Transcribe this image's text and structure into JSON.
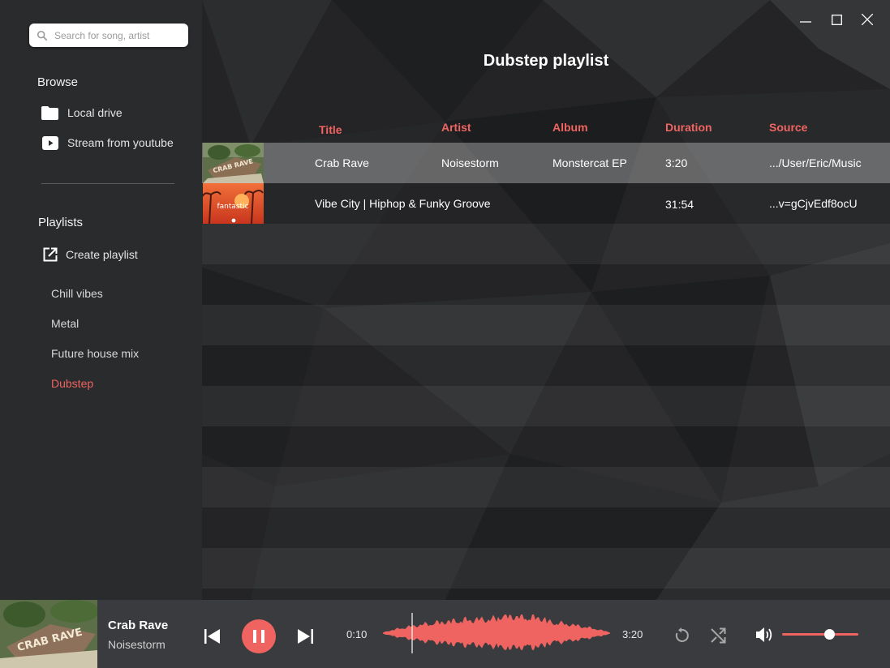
{
  "search": {
    "placeholder": "Search for song, artist"
  },
  "sidebar": {
    "browse_title": "Browse",
    "browse_items": [
      {
        "label": "Local drive",
        "icon": "folder-icon"
      },
      {
        "label": "Stream from youtube",
        "icon": "youtube-icon"
      }
    ],
    "playlists_title": "Playlists",
    "create_label": "Create playlist",
    "playlists": [
      "Chill vibes",
      "Metal",
      "Future house mix",
      "Dubstep"
    ],
    "active_playlist": "Dubstep"
  },
  "main": {
    "title": "Dubstep playlist",
    "columns": [
      "Title",
      "Artist",
      "Album",
      "Duration",
      "Source"
    ],
    "tracks": [
      {
        "thumb_text": "CRAB RAVE",
        "title": "Crab Rave",
        "artist": "Noisestorm",
        "album": "Monstercat EP",
        "duration": "3:20",
        "source": ".../User/Eric/Music"
      },
      {
        "thumb_text": "fantastic",
        "title": "Vibe City | Hiphop & Funky Groove",
        "artist": "",
        "album": "",
        "duration": "31:54",
        "source": "...v=gCjvEdf8ocU"
      }
    ]
  },
  "player": {
    "title": "Crab Rave",
    "artist": "Noisestorm",
    "art_text": "CRAB RAVE",
    "elapsed": "0:10",
    "total": "3:20",
    "progress_fraction": 0.05,
    "volume_fraction": 0.6
  },
  "colors": {
    "accent": "#ef6461",
    "sidebar": "#2a2b2d",
    "player": "#3a3b3e"
  }
}
